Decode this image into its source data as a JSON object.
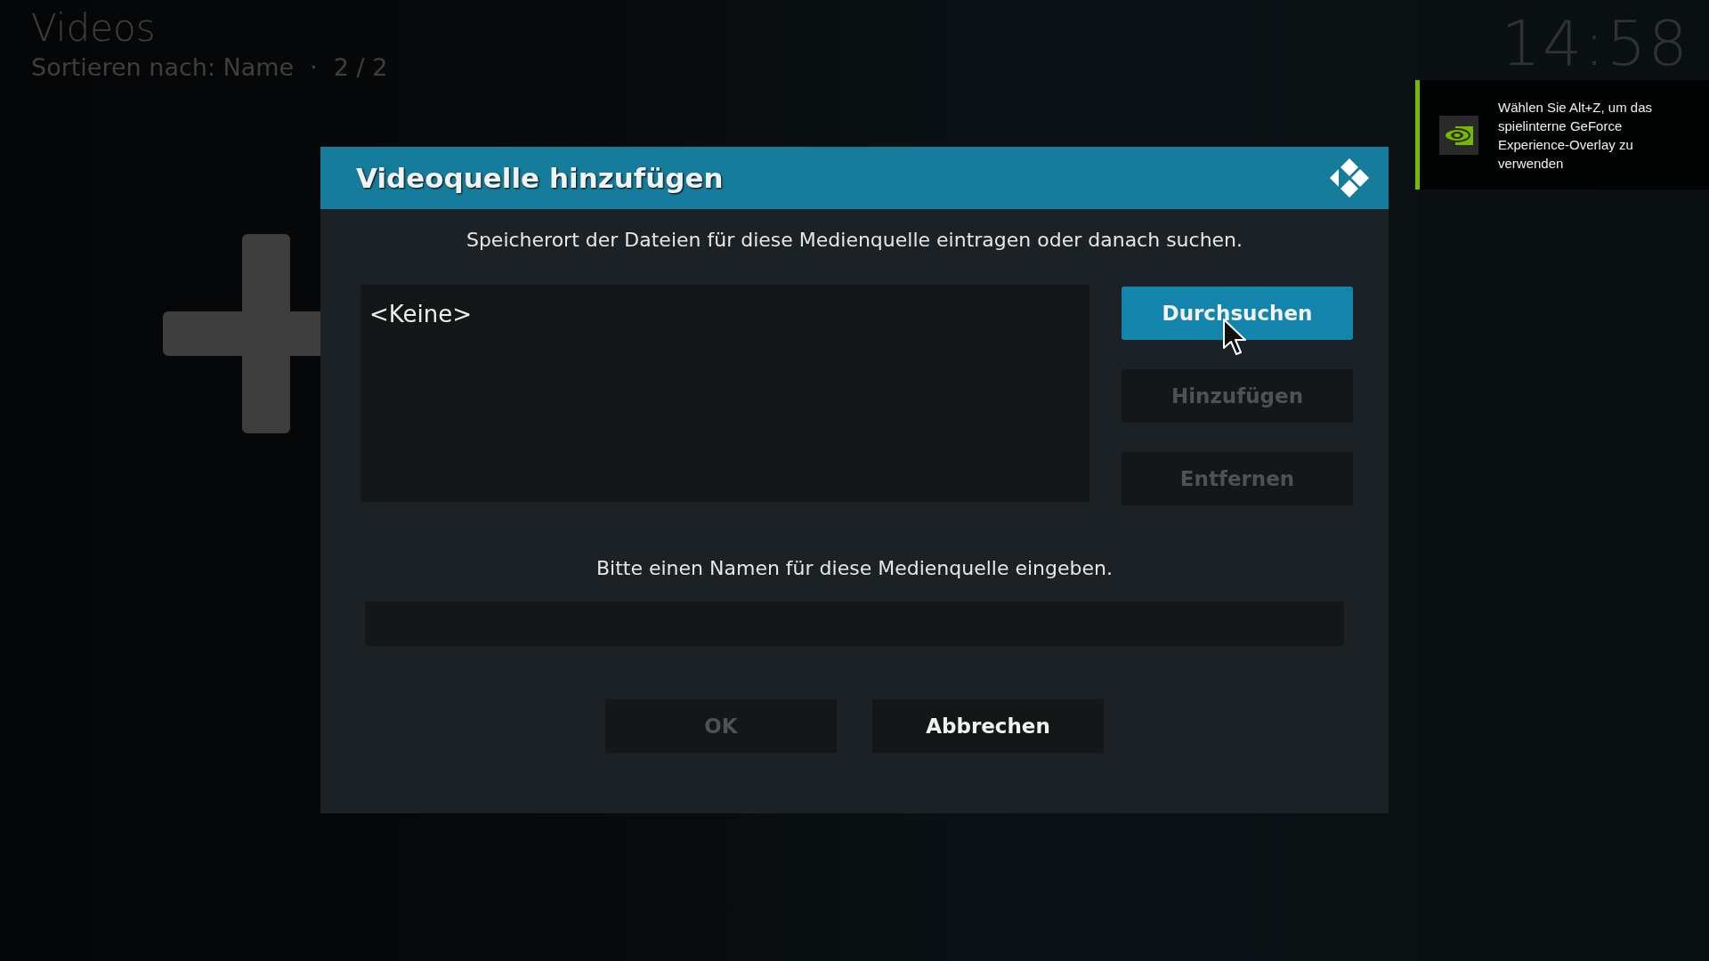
{
  "header": {
    "title": "Videos",
    "sort_label": "Sortieren nach: Name",
    "separator": "·",
    "count": "2 / 2"
  },
  "clock": "14:58",
  "notification": {
    "text": "Wählen Sie Alt+Z, um das spielinterne GeForce Experience-Overlay zu verwenden"
  },
  "dialog": {
    "title": "Videoquelle hinzufügen",
    "instruction": "Speicherort der Dateien für diese Medienquelle eintragen oder danach suchen.",
    "paths": [
      {
        "label": "<Keine>"
      }
    ],
    "side_buttons": [
      {
        "label": "Durchsuchen",
        "focused": true,
        "disabled": false
      },
      {
        "label": "Hinzufügen",
        "focused": false,
        "disabled": true
      },
      {
        "label": "Entfernen",
        "focused": false,
        "disabled": true
      }
    ],
    "name_prompt": "Bitte einen Namen für diese Medienquelle eingeben.",
    "footer_buttons": [
      {
        "label": "OK",
        "focused": false,
        "disabled": true
      },
      {
        "label": "Abbrechen",
        "focused": false,
        "disabled": false
      }
    ]
  }
}
